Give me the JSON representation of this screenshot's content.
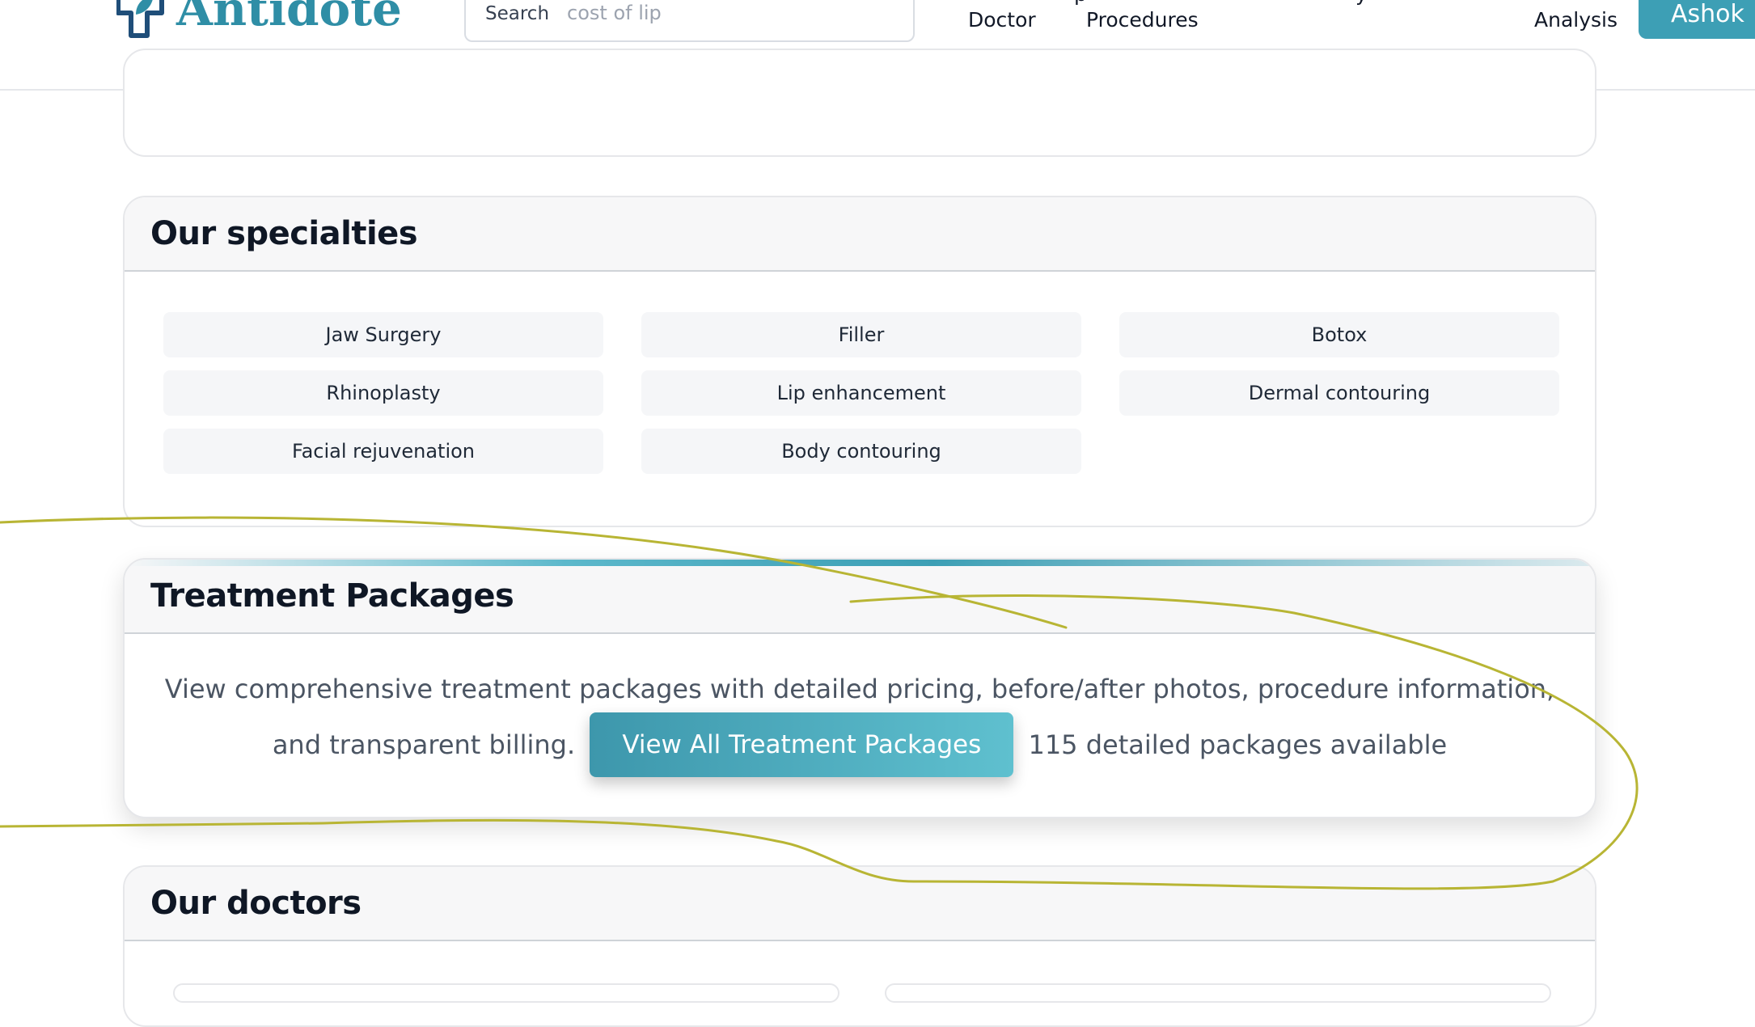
{
  "header": {
    "logo_text": "Antidote",
    "search": {
      "label": "Search",
      "value": "cost of lip"
    },
    "nav": [
      {
        "label": "Doctor"
      },
      {
        "label": "Procedures"
      },
      {
        "label": "Analysis"
      }
    ],
    "user_button": "Ashok"
  },
  "specialties": {
    "title": "Our specialties",
    "items": [
      "Jaw Surgery",
      "Filler",
      "Botox",
      "Rhinoplasty",
      "Lip enhancement",
      "Dermal contouring",
      "Facial rejuvenation",
      "Body contouring"
    ]
  },
  "treatment_packages": {
    "title": "Treatment Packages",
    "description": "View comprehensive treatment packages with detailed pricing, before/after photos, procedure information, and transparent billing.",
    "button": "View All Treatment Packages",
    "count_text": "115 detailed packages available"
  },
  "doctors": {
    "title": "Our doctors"
  },
  "colors": {
    "accent": "#3d9fb5",
    "title_text": "#0f1725",
    "annotation_stroke": "#b8b534"
  }
}
